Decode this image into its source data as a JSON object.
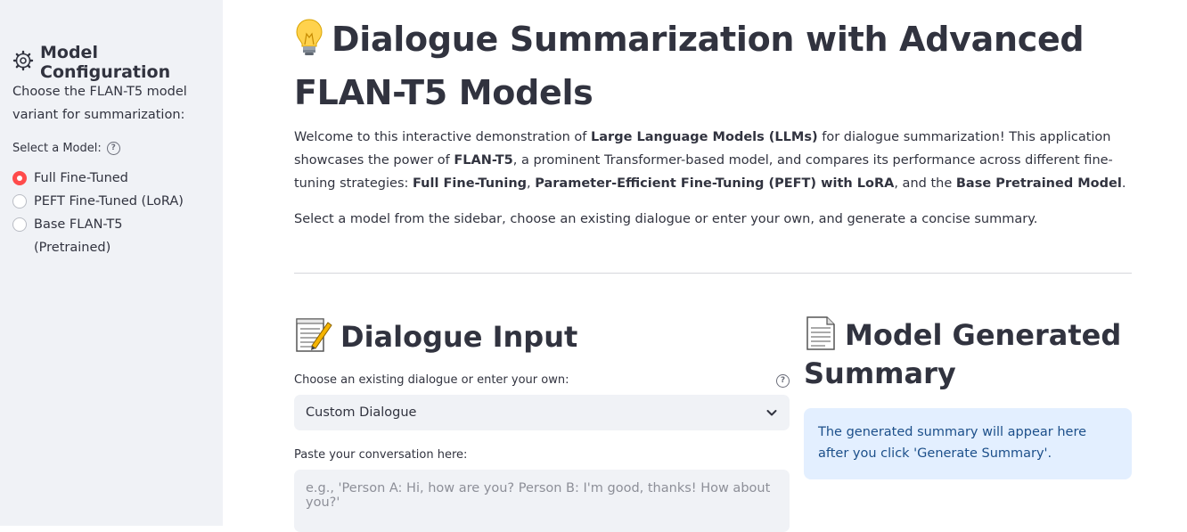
{
  "sidebar": {
    "title": "Model Configuration",
    "description": "Choose the FLAN-T5 model variant for summarization:",
    "select_label": "Select a Model:",
    "options": [
      {
        "label": "Full Fine-Tuned",
        "selected": true
      },
      {
        "label": "PEFT Fine-Tuned (LoRA)",
        "selected": false
      },
      {
        "label": "Base FLAN-T5 (Pretrained)",
        "selected": false
      }
    ]
  },
  "main": {
    "title": "Dialogue Summarization with Advanced FLAN-T5 Models",
    "intro": {
      "p1_a": "Welcome to this interactive demonstration of ",
      "p1_b": "Large Language Models (LLMs)",
      "p1_c": " for dialogue summarization! This application showcases the power of ",
      "p1_d": "FLAN-T5",
      "p1_e": ", a prominent Transformer-based model, and compares its performance across different fine-tuning strategies: ",
      "p1_f": "Full Fine-Tuning",
      "p1_g": ", ",
      "p1_h": "Parameter-Efficient Fine-Tuning (PEFT) with LoRA",
      "p1_i": ", and the ",
      "p1_j": "Base Pretrained Model",
      "p1_k": ".",
      "p2": "Select a model from the sidebar, choose an existing dialogue or enter your own, and generate a concise summary."
    },
    "input_section": {
      "heading": "Dialogue Input",
      "choose_label": "Choose an existing dialogue or enter your own:",
      "select_value": "Custom Dialogue",
      "paste_label": "Paste your conversation here:",
      "placeholder": "e.g., 'Person A: Hi, how are you? Person B: I'm good, thanks! How about you?'"
    },
    "summary_section": {
      "heading": "Model Generated Summary",
      "info": "The generated summary will appear here after you click 'Generate Summary'."
    }
  },
  "colors": {
    "accent": "#ff4b4b",
    "sidebar_bg": "#f0f2f6",
    "info_bg": "#e3efff",
    "info_text": "#1c4f8a"
  },
  "icons": [
    "gear-icon",
    "help-icon",
    "lightbulb-icon",
    "memo-icon",
    "document-icon",
    "chevron-down-icon"
  ]
}
